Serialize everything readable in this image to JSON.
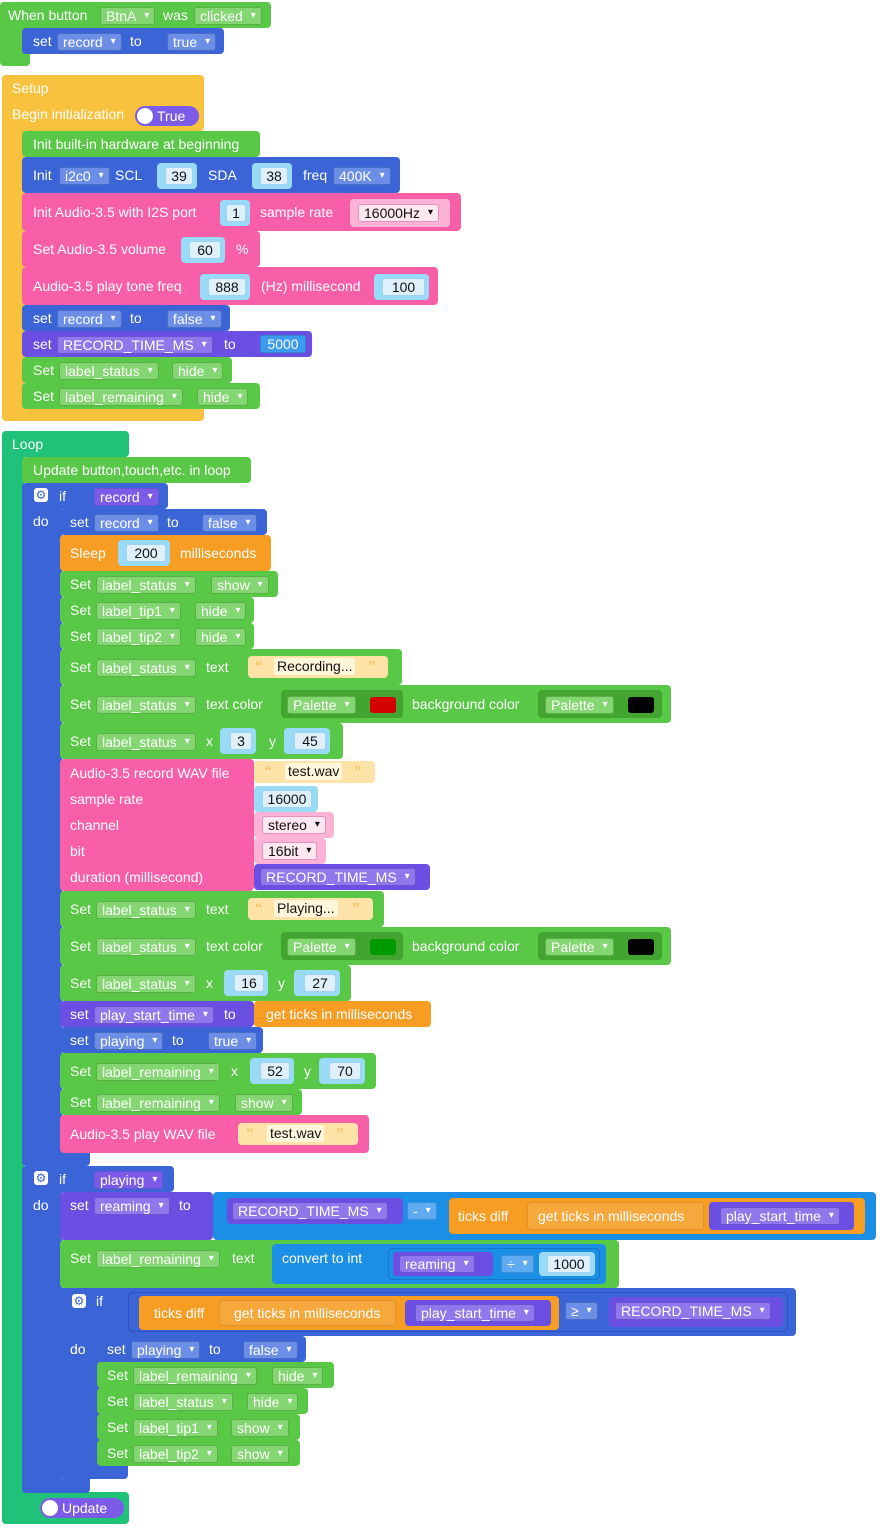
{
  "event_block": {
    "when": "When button",
    "button": "BtnA",
    "was": "was",
    "action": "clicked",
    "set": "set",
    "var": "record",
    "to": "to",
    "value": "true"
  },
  "setup": {
    "title": "Setup",
    "begin_init": "Begin initialization",
    "begin_toggle": "True",
    "init_hw": "Init built-in hardware at beginning",
    "i2c": {
      "init": "Init",
      "bus": "i2c0",
      "scl_label": "SCL",
      "scl": "39",
      "sda_label": "SDA",
      "sda": "38",
      "freq_label": "freq",
      "freq": "400K"
    },
    "audio_init": {
      "label": "Init Audio-3.5 with I2S port",
      "port": "1",
      "rate_label": "sample rate",
      "rate": "16000Hz"
    },
    "volume": {
      "label": "Set Audio-3.5 volume",
      "value": "60",
      "unit": "%"
    },
    "tone": {
      "label": "Audio-3.5 play tone freq",
      "freq": "888",
      "mid": "(Hz) millisecond",
      "ms": "100"
    },
    "set_record": {
      "set": "set",
      "var": "record",
      "to": "to",
      "value": "false"
    },
    "set_time": {
      "set": "set",
      "var": "RECORD_TIME_MS",
      "to": "to",
      "value": "5000"
    },
    "hide_status": {
      "set": "Set",
      "target": "label_status",
      "action": "hide"
    },
    "hide_remaining": {
      "set": "Set",
      "target": "label_remaining",
      "action": "hide"
    }
  },
  "loop": {
    "title": "Loop",
    "update": "Update button,touch,etc. in loop",
    "if1": {
      "if": "if",
      "cond": "record",
      "do": "do"
    },
    "set_record_false": {
      "set": "set",
      "var": "record",
      "to": "to",
      "value": "false"
    },
    "sleep": {
      "label": "Sleep",
      "value": "200",
      "unit": "milliseconds"
    },
    "show_status": {
      "set": "Set",
      "target": "label_status",
      "action": "show"
    },
    "hide_tip1": {
      "set": "Set",
      "target": "label_tip1",
      "action": "hide"
    },
    "hide_tip2": {
      "set": "Set",
      "target": "label_tip2",
      "action": "hide"
    },
    "status_text1": {
      "set": "Set",
      "target": "label_status",
      "prop": "text",
      "value": "Recording..."
    },
    "status_color1": {
      "set": "Set",
      "target": "label_status",
      "prop": "text color",
      "palette": "Palette",
      "bg_label": "background color",
      "bg_palette": "Palette"
    },
    "status_xy1": {
      "set": "Set",
      "target": "label_status",
      "x_label": "x",
      "x": "3",
      "y_label": "y",
      "y": "45"
    },
    "record_wav": {
      "label": "Audio-3.5 record WAV file",
      "file": "test.wav",
      "rate_label": "sample rate",
      "rate": "16000",
      "channel_label": "channel",
      "channel": "stereo",
      "bit_label": "bit",
      "bit": "16bit",
      "duration_label": "duration (millisecond)",
      "duration": "RECORD_TIME_MS"
    },
    "status_text2": {
      "set": "Set",
      "target": "label_status",
      "prop": "text",
      "value": "Playing..."
    },
    "status_color2": {
      "set": "Set",
      "target": "label_status",
      "prop": "text color",
      "palette": "Palette",
      "bg_label": "background color",
      "bg_palette": "Palette"
    },
    "status_xy2": {
      "set": "Set",
      "target": "label_status",
      "x_label": "x",
      "x": "16",
      "y_label": "y",
      "y": "27"
    },
    "set_start": {
      "set": "set",
      "var": "play_start_time",
      "to": "to",
      "value": "get ticks in milliseconds"
    },
    "set_playing": {
      "set": "set",
      "var": "playing",
      "to": "to",
      "value": "true"
    },
    "remaining_xy": {
      "set": "Set",
      "target": "label_remaining",
      "x_label": "x",
      "x": "52",
      "y_label": "y",
      "y": "70"
    },
    "show_remaining": {
      "set": "Set",
      "target": "label_remaining",
      "action": "show"
    },
    "play_wav": {
      "label": "Audio-3.5 play WAV file",
      "file": "test.wav"
    },
    "if2": {
      "if": "if",
      "cond": "playing",
      "do": "do"
    },
    "set_reaming": {
      "set": "set",
      "var": "reaming",
      "to": "to",
      "lhs": "RECORD_TIME_MS",
      "op": "-",
      "ticks": "ticks diff",
      "get": "get ticks in milliseconds",
      "start": "play_start_time"
    },
    "remaining_text": {
      "set": "Set",
      "target": "label_remaining",
      "prop": "text",
      "convert": "convert to int",
      "var": "reaming",
      "op": "÷",
      "div": "1000"
    },
    "if3": {
      "if": "if",
      "do": "do",
      "ticks": "ticks diff",
      "get": "get ticks in milliseconds",
      "start": "play_start_time",
      "op": "≥",
      "rhs": "RECORD_TIME_MS"
    },
    "set_playing_false": {
      "set": "set",
      "var": "playing",
      "to": "to",
      "value": "false"
    },
    "hide_remaining2": {
      "set": "Set",
      "target": "label_remaining",
      "action": "hide"
    },
    "hide_status2": {
      "set": "Set",
      "target": "label_status",
      "action": "hide"
    },
    "show_tip1": {
      "set": "Set",
      "target": "label_tip1",
      "action": "show"
    },
    "show_tip2": {
      "set": "Set",
      "target": "label_tip2",
      "action": "show"
    },
    "update_toggle": "Update"
  },
  "colors": {
    "red_swatch": "#d40000",
    "green_swatch": "#009a00",
    "black_swatch": "#000000"
  }
}
